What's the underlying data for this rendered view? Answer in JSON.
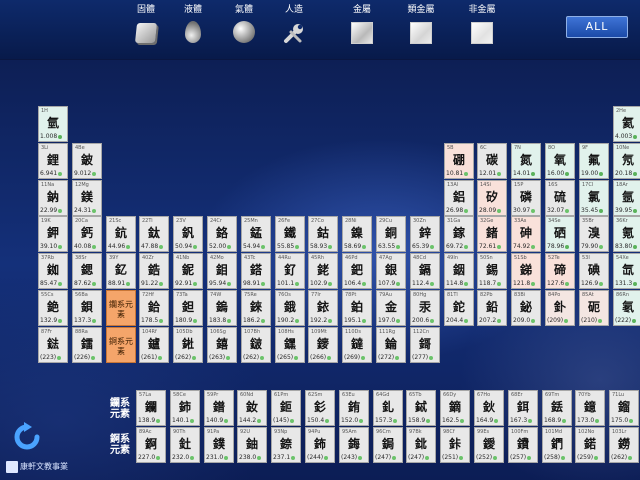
{
  "toolbar": {
    "legend": [
      {
        "label": "固體",
        "icon": "solid-cube-icon"
      },
      {
        "label": "液體",
        "icon": "liquid-drop-icon"
      },
      {
        "label": "氣體",
        "icon": "gas-sphere-icon"
      },
      {
        "label": "人造",
        "icon": "wrench-tool-icon"
      },
      {
        "label": "金屬",
        "icon": "metal-swatch-icon"
      },
      {
        "label": "類金屬",
        "icon": "metalloid-swatch-icon"
      },
      {
        "label": "非金屬",
        "icon": "nonmetal-swatch-icon"
      }
    ],
    "all_button": "ALL"
  },
  "series_labels": {
    "lanthanide": "鑭系元素",
    "actinide": "錒系元素"
  },
  "placeholders": {
    "lanthanide": "鑭系元素",
    "actinide": "錒系元素"
  },
  "logo_text": "康軒文教事業",
  "colors": {
    "toolbar": "#0e2a6b",
    "background": "#14307a",
    "cell": "#e8e8e8",
    "gas_cell": "#e1f2ec",
    "metalloid_cell": "#f9e1da",
    "series_placeholder": "#f5a56a",
    "all_button": "#2a5ec0"
  },
  "elements": [
    {
      "z": "1",
      "sym": "H",
      "name": "氫",
      "mass": "1.008",
      "row": 1,
      "col": 1,
      "t": "gas"
    },
    {
      "z": "2",
      "sym": "He",
      "name": "氦",
      "mass": "4.003",
      "row": 1,
      "col": 18,
      "t": "gas"
    },
    {
      "z": "3",
      "sym": "Li",
      "name": "鋰",
      "mass": "6.941",
      "row": 2,
      "col": 1
    },
    {
      "z": "4",
      "sym": "Be",
      "name": "鈹",
      "mass": "9.012",
      "row": 2,
      "col": 2
    },
    {
      "z": "5",
      "sym": "B",
      "name": "硼",
      "mass": "10.81",
      "row": 2,
      "col": 13,
      "t": "metalloid"
    },
    {
      "z": "6",
      "sym": "C",
      "name": "碳",
      "mass": "12.01",
      "row": 2,
      "col": 14
    },
    {
      "z": "7",
      "sym": "N",
      "name": "氮",
      "mass": "14.01",
      "row": 2,
      "col": 15,
      "t": "gas"
    },
    {
      "z": "8",
      "sym": "O",
      "name": "氧",
      "mass": "16.00",
      "row": 2,
      "col": 16,
      "t": "gas"
    },
    {
      "z": "9",
      "sym": "F",
      "name": "氟",
      "mass": "19.00",
      "row": 2,
      "col": 17,
      "t": "gas"
    },
    {
      "z": "10",
      "sym": "Ne",
      "name": "氖",
      "mass": "20.18",
      "row": 2,
      "col": 18,
      "t": "gas"
    },
    {
      "z": "11",
      "sym": "Na",
      "name": "鈉",
      "mass": "22.99",
      "row": 3,
      "col": 1
    },
    {
      "z": "12",
      "sym": "Mg",
      "name": "鎂",
      "mass": "24.31",
      "row": 3,
      "col": 2
    },
    {
      "z": "13",
      "sym": "Al",
      "name": "鋁",
      "mass": "26.98",
      "row": 3,
      "col": 13
    },
    {
      "z": "14",
      "sym": "Si",
      "name": "矽",
      "mass": "28.09",
      "row": 3,
      "col": 14,
      "t": "metalloid"
    },
    {
      "z": "15",
      "sym": "P",
      "name": "磷",
      "mass": "30.97",
      "row": 3,
      "col": 15
    },
    {
      "z": "16",
      "sym": "S",
      "name": "硫",
      "mass": "32.07",
      "row": 3,
      "col": 16
    },
    {
      "z": "17",
      "sym": "Cl",
      "name": "氯",
      "mass": "35.45",
      "row": 3,
      "col": 17,
      "t": "gas"
    },
    {
      "z": "18",
      "sym": "Ar",
      "name": "氬",
      "mass": "39.95",
      "row": 3,
      "col": 18,
      "t": "gas"
    },
    {
      "z": "19",
      "sym": "K",
      "name": "鉀",
      "mass": "39.10",
      "row": 4,
      "col": 1
    },
    {
      "z": "20",
      "sym": "Ca",
      "name": "鈣",
      "mass": "40.08",
      "row": 4,
      "col": 2
    },
    {
      "z": "21",
      "sym": "Sc",
      "name": "鈧",
      "mass": "44.96",
      "row": 4,
      "col": 3
    },
    {
      "z": "22",
      "sym": "Ti",
      "name": "鈦",
      "mass": "47.88",
      "row": 4,
      "col": 4
    },
    {
      "z": "23",
      "sym": "V",
      "name": "釩",
      "mass": "50.94",
      "row": 4,
      "col": 5
    },
    {
      "z": "24",
      "sym": "Cr",
      "name": "鉻",
      "mass": "52.00",
      "row": 4,
      "col": 6
    },
    {
      "z": "25",
      "sym": "Mn",
      "name": "錳",
      "mass": "54.94",
      "row": 4,
      "col": 7
    },
    {
      "z": "26",
      "sym": "Fe",
      "name": "鐵",
      "mass": "55.85",
      "row": 4,
      "col": 8
    },
    {
      "z": "27",
      "sym": "Co",
      "name": "鈷",
      "mass": "58.93",
      "row": 4,
      "col": 9
    },
    {
      "z": "28",
      "sym": "Ni",
      "name": "鎳",
      "mass": "58.69",
      "row": 4,
      "col": 10
    },
    {
      "z": "29",
      "sym": "Cu",
      "name": "銅",
      "mass": "63.55",
      "row": 4,
      "col": 11
    },
    {
      "z": "30",
      "sym": "Zn",
      "name": "鋅",
      "mass": "65.39",
      "row": 4,
      "col": 12
    },
    {
      "z": "31",
      "sym": "Ga",
      "name": "鎵",
      "mass": "69.72",
      "row": 4,
      "col": 13
    },
    {
      "z": "32",
      "sym": "Ge",
      "name": "鍺",
      "mass": "72.61",
      "row": 4,
      "col": 14,
      "t": "metalloid"
    },
    {
      "z": "33",
      "sym": "As",
      "name": "砷",
      "mass": "74.92",
      "row": 4,
      "col": 15,
      "t": "metalloid"
    },
    {
      "z": "34",
      "sym": "Se",
      "name": "硒",
      "mass": "78.96",
      "row": 4,
      "col": 16,
      "t": "gas"
    },
    {
      "z": "35",
      "sym": "Br",
      "name": "溴",
      "mass": "79.90",
      "row": 4,
      "col": 17
    },
    {
      "z": "36",
      "sym": "Kr",
      "name": "氪",
      "mass": "83.80",
      "row": 4,
      "col": 18,
      "t": "gas"
    },
    {
      "z": "37",
      "sym": "Rb",
      "name": "銣",
      "mass": "85.47",
      "row": 5,
      "col": 1
    },
    {
      "z": "38",
      "sym": "Sr",
      "name": "鍶",
      "mass": "87.62",
      "row": 5,
      "col": 2
    },
    {
      "z": "39",
      "sym": "Y",
      "name": "釔",
      "mass": "88.91",
      "row": 5,
      "col": 3
    },
    {
      "z": "40",
      "sym": "Zr",
      "name": "鋯",
      "mass": "91.22",
      "row": 5,
      "col": 4
    },
    {
      "z": "41",
      "sym": "Nb",
      "name": "鈮",
      "mass": "92.91",
      "row": 5,
      "col": 5
    },
    {
      "z": "42",
      "sym": "Mo",
      "name": "鉬",
      "mass": "95.94",
      "row": 5,
      "col": 6
    },
    {
      "z": "43",
      "sym": "Tc",
      "name": "鎝",
      "mass": "98.91",
      "row": 5,
      "col": 7
    },
    {
      "z": "44",
      "sym": "Ru",
      "name": "釕",
      "mass": "101.1",
      "row": 5,
      "col": 8
    },
    {
      "z": "45",
      "sym": "Rh",
      "name": "銠",
      "mass": "102.9",
      "row": 5,
      "col": 9
    },
    {
      "z": "46",
      "sym": "Pd",
      "name": "鈀",
      "mass": "106.4",
      "row": 5,
      "col": 10
    },
    {
      "z": "47",
      "sym": "Ag",
      "name": "銀",
      "mass": "107.9",
      "row": 5,
      "col": 11
    },
    {
      "z": "48",
      "sym": "Cd",
      "name": "鎘",
      "mass": "112.4",
      "row": 5,
      "col": 12
    },
    {
      "z": "49",
      "sym": "In",
      "name": "銦",
      "mass": "114.8",
      "row": 5,
      "col": 13
    },
    {
      "z": "50",
      "sym": "Sn",
      "name": "錫",
      "mass": "118.7",
      "row": 5,
      "col": 14
    },
    {
      "z": "51",
      "sym": "Sb",
      "name": "銻",
      "mass": "121.8",
      "row": 5,
      "col": 15,
      "t": "metalloid"
    },
    {
      "z": "52",
      "sym": "Te",
      "name": "碲",
      "mass": "127.6",
      "row": 5,
      "col": 16,
      "t": "metalloid"
    },
    {
      "z": "53",
      "sym": "I",
      "name": "碘",
      "mass": "126.9",
      "row": 5,
      "col": 17
    },
    {
      "z": "54",
      "sym": "Xe",
      "name": "氙",
      "mass": "131.3",
      "row": 5,
      "col": 18,
      "t": "gas"
    },
    {
      "z": "55",
      "sym": "Cs",
      "name": "銫",
      "mass": "132.9",
      "row": 6,
      "col": 1
    },
    {
      "z": "56",
      "sym": "Ba",
      "name": "鋇",
      "mass": "137.3",
      "row": 6,
      "col": 2
    },
    {
      "z": "72",
      "sym": "Hf",
      "name": "鉿",
      "mass": "178.5",
      "row": 6,
      "col": 4
    },
    {
      "z": "73",
      "sym": "Ta",
      "name": "鉭",
      "mass": "180.9",
      "row": 6,
      "col": 5
    },
    {
      "z": "74",
      "sym": "W",
      "name": "鎢",
      "mass": "183.8",
      "row": 6,
      "col": 6
    },
    {
      "z": "75",
      "sym": "Re",
      "name": "錸",
      "mass": "186.2",
      "row": 6,
      "col": 7
    },
    {
      "z": "76",
      "sym": "Os",
      "name": "鋨",
      "mass": "190.2",
      "row": 6,
      "col": 8
    },
    {
      "z": "77",
      "sym": "Ir",
      "name": "銥",
      "mass": "192.2",
      "row": 6,
      "col": 9
    },
    {
      "z": "78",
      "sym": "Pt",
      "name": "鉑",
      "mass": "195.1",
      "row": 6,
      "col": 10
    },
    {
      "z": "79",
      "sym": "Au",
      "name": "金",
      "mass": "197.0",
      "row": 6,
      "col": 11
    },
    {
      "z": "80",
      "sym": "Hg",
      "name": "汞",
      "mass": "200.6",
      "row": 6,
      "col": 12
    },
    {
      "z": "81",
      "sym": "Tl",
      "name": "鉈",
      "mass": "204.4",
      "row": 6,
      "col": 13
    },
    {
      "z": "82",
      "sym": "Pb",
      "name": "鉛",
      "mass": "207.2",
      "row": 6,
      "col": 14
    },
    {
      "z": "83",
      "sym": "Bi",
      "name": "鉍",
      "mass": "209.0",
      "row": 6,
      "col": 15
    },
    {
      "z": "84",
      "sym": "Po",
      "name": "釙",
      "mass": "(209)",
      "row": 6,
      "col": 16,
      "t": "nm"
    },
    {
      "z": "85",
      "sym": "At",
      "name": "砈",
      "mass": "(210)",
      "row": 6,
      "col": 17,
      "t": "nm"
    },
    {
      "z": "86",
      "sym": "Rn",
      "name": "氡",
      "mass": "(222)",
      "row": 6,
      "col": 18,
      "t": "gas"
    },
    {
      "z": "87",
      "sym": "Fr",
      "name": "鍅",
      "mass": "(223)",
      "row": 7,
      "col": 1
    },
    {
      "z": "88",
      "sym": "Ra",
      "name": "鐳",
      "mass": "(226)",
      "row": 7,
      "col": 2
    },
    {
      "z": "104",
      "sym": "Rf",
      "name": "鑪",
      "mass": "(261)",
      "row": 7,
      "col": 4
    },
    {
      "z": "105",
      "sym": "Db",
      "name": "𨧀",
      "mass": "(262)",
      "row": 7,
      "col": 5
    },
    {
      "z": "106",
      "sym": "Sg",
      "name": "𨭎",
      "mass": "(263)",
      "row": 7,
      "col": 6
    },
    {
      "z": "107",
      "sym": "Bh",
      "name": "𨨏",
      "mass": "(262)",
      "row": 7,
      "col": 7
    },
    {
      "z": "108",
      "sym": "Hs",
      "name": "𨭆",
      "mass": "(265)",
      "row": 7,
      "col": 8
    },
    {
      "z": "109",
      "sym": "Mt",
      "name": "䥑",
      "mass": "(266)",
      "row": 7,
      "col": 9
    },
    {
      "z": "110",
      "sym": "Ds",
      "name": "鐽",
      "mass": "(269)",
      "row": 7,
      "col": 10
    },
    {
      "z": "111",
      "sym": "Rg",
      "name": "錀",
      "mass": "(272)",
      "row": 7,
      "col": 11
    },
    {
      "z": "112",
      "sym": "Cn",
      "name": "鎶",
      "mass": "(277)",
      "row": 7,
      "col": 12
    }
  ],
  "lanthanides": [
    {
      "z": "57",
      "sym": "La",
      "name": "鑭",
      "mass": "138.9"
    },
    {
      "z": "58",
      "sym": "Ce",
      "name": "鈰",
      "mass": "140.1"
    },
    {
      "z": "59",
      "sym": "Pr",
      "name": "鐠",
      "mass": "140.9"
    },
    {
      "z": "60",
      "sym": "Nd",
      "name": "釹",
      "mass": "144.2"
    },
    {
      "z": "61",
      "sym": "Pm",
      "name": "鉕",
      "mass": "(145)"
    },
    {
      "z": "62",
      "sym": "Sm",
      "name": "釤",
      "mass": "150.4"
    },
    {
      "z": "63",
      "sym": "Eu",
      "name": "銪",
      "mass": "152.0"
    },
    {
      "z": "64",
      "sym": "Gd",
      "name": "釓",
      "mass": "157.3"
    },
    {
      "z": "65",
      "sym": "Tb",
      "name": "鋱",
      "mass": "158.9"
    },
    {
      "z": "66",
      "sym": "Dy",
      "name": "鏑",
      "mass": "162.5"
    },
    {
      "z": "67",
      "sym": "Ho",
      "name": "鈥",
      "mass": "164.9"
    },
    {
      "z": "68",
      "sym": "Er",
      "name": "鉺",
      "mass": "167.3"
    },
    {
      "z": "69",
      "sym": "Tm",
      "name": "銩",
      "mass": "168.9"
    },
    {
      "z": "70",
      "sym": "Yb",
      "name": "鐿",
      "mass": "173.0"
    },
    {
      "z": "71",
      "sym": "Lu",
      "name": "鎦",
      "mass": "175.0"
    }
  ],
  "actinides": [
    {
      "z": "89",
      "sym": "Ac",
      "name": "錒",
      "mass": "227.0"
    },
    {
      "z": "90",
      "sym": "Th",
      "name": "釷",
      "mass": "232.0"
    },
    {
      "z": "91",
      "sym": "Pa",
      "name": "鏷",
      "mass": "231.0"
    },
    {
      "z": "92",
      "sym": "U",
      "name": "鈾",
      "mass": "238.0"
    },
    {
      "z": "93",
      "sym": "Np",
      "name": "錼",
      "mass": "237.1"
    },
    {
      "z": "94",
      "sym": "Pu",
      "name": "鈽",
      "mass": "(244)"
    },
    {
      "z": "95",
      "sym": "Am",
      "name": "鋂",
      "mass": "(243)"
    },
    {
      "z": "96",
      "sym": "Cm",
      "name": "鋦",
      "mass": "(247)"
    },
    {
      "z": "97",
      "sym": "Bk",
      "name": "鉳",
      "mass": "(247)"
    },
    {
      "z": "98",
      "sym": "Cf",
      "name": "鉲",
      "mass": "(251)"
    },
    {
      "z": "99",
      "sym": "Es",
      "name": "鑀",
      "mass": "(252)"
    },
    {
      "z": "100",
      "sym": "Fm",
      "name": "鐨",
      "mass": "(257)"
    },
    {
      "z": "101",
      "sym": "Md",
      "name": "鍆",
      "mass": "(258)"
    },
    {
      "z": "102",
      "sym": "No",
      "name": "鍩",
      "mass": "(259)"
    },
    {
      "z": "103",
      "sym": "Lr",
      "name": "鐒",
      "mass": "(262)"
    }
  ]
}
